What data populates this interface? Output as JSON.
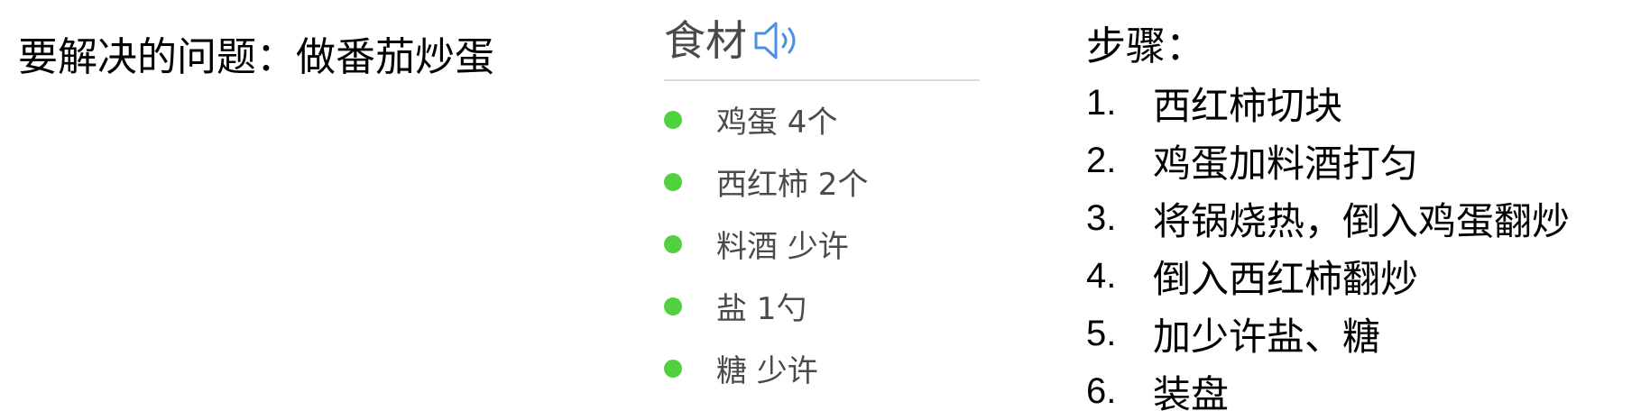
{
  "problem": {
    "text": "要解决的问题：做番茄炒蛋"
  },
  "ingredients": {
    "title": "食材",
    "icon": "speaker-icon",
    "accent_color": "#4a90e2",
    "dot_color": "#52d140",
    "items": [
      {
        "label": "鸡蛋 4个"
      },
      {
        "label": "西红柿 2个"
      },
      {
        "label": "料酒 少许"
      },
      {
        "label": "盐 1勺"
      },
      {
        "label": "糖 少许"
      }
    ]
  },
  "steps": {
    "title": "步骤：",
    "items": [
      {
        "num": "1.",
        "text": "西红柿切块"
      },
      {
        "num": "2.",
        "text": "鸡蛋加料酒打匀"
      },
      {
        "num": "3.",
        "text": "将锅烧热，倒入鸡蛋翻炒"
      },
      {
        "num": "4.",
        "text": "倒入西红柿翻炒"
      },
      {
        "num": "5.",
        "text": "加少许盐、糖"
      },
      {
        "num": "6.",
        "text": "装盘"
      }
    ]
  }
}
